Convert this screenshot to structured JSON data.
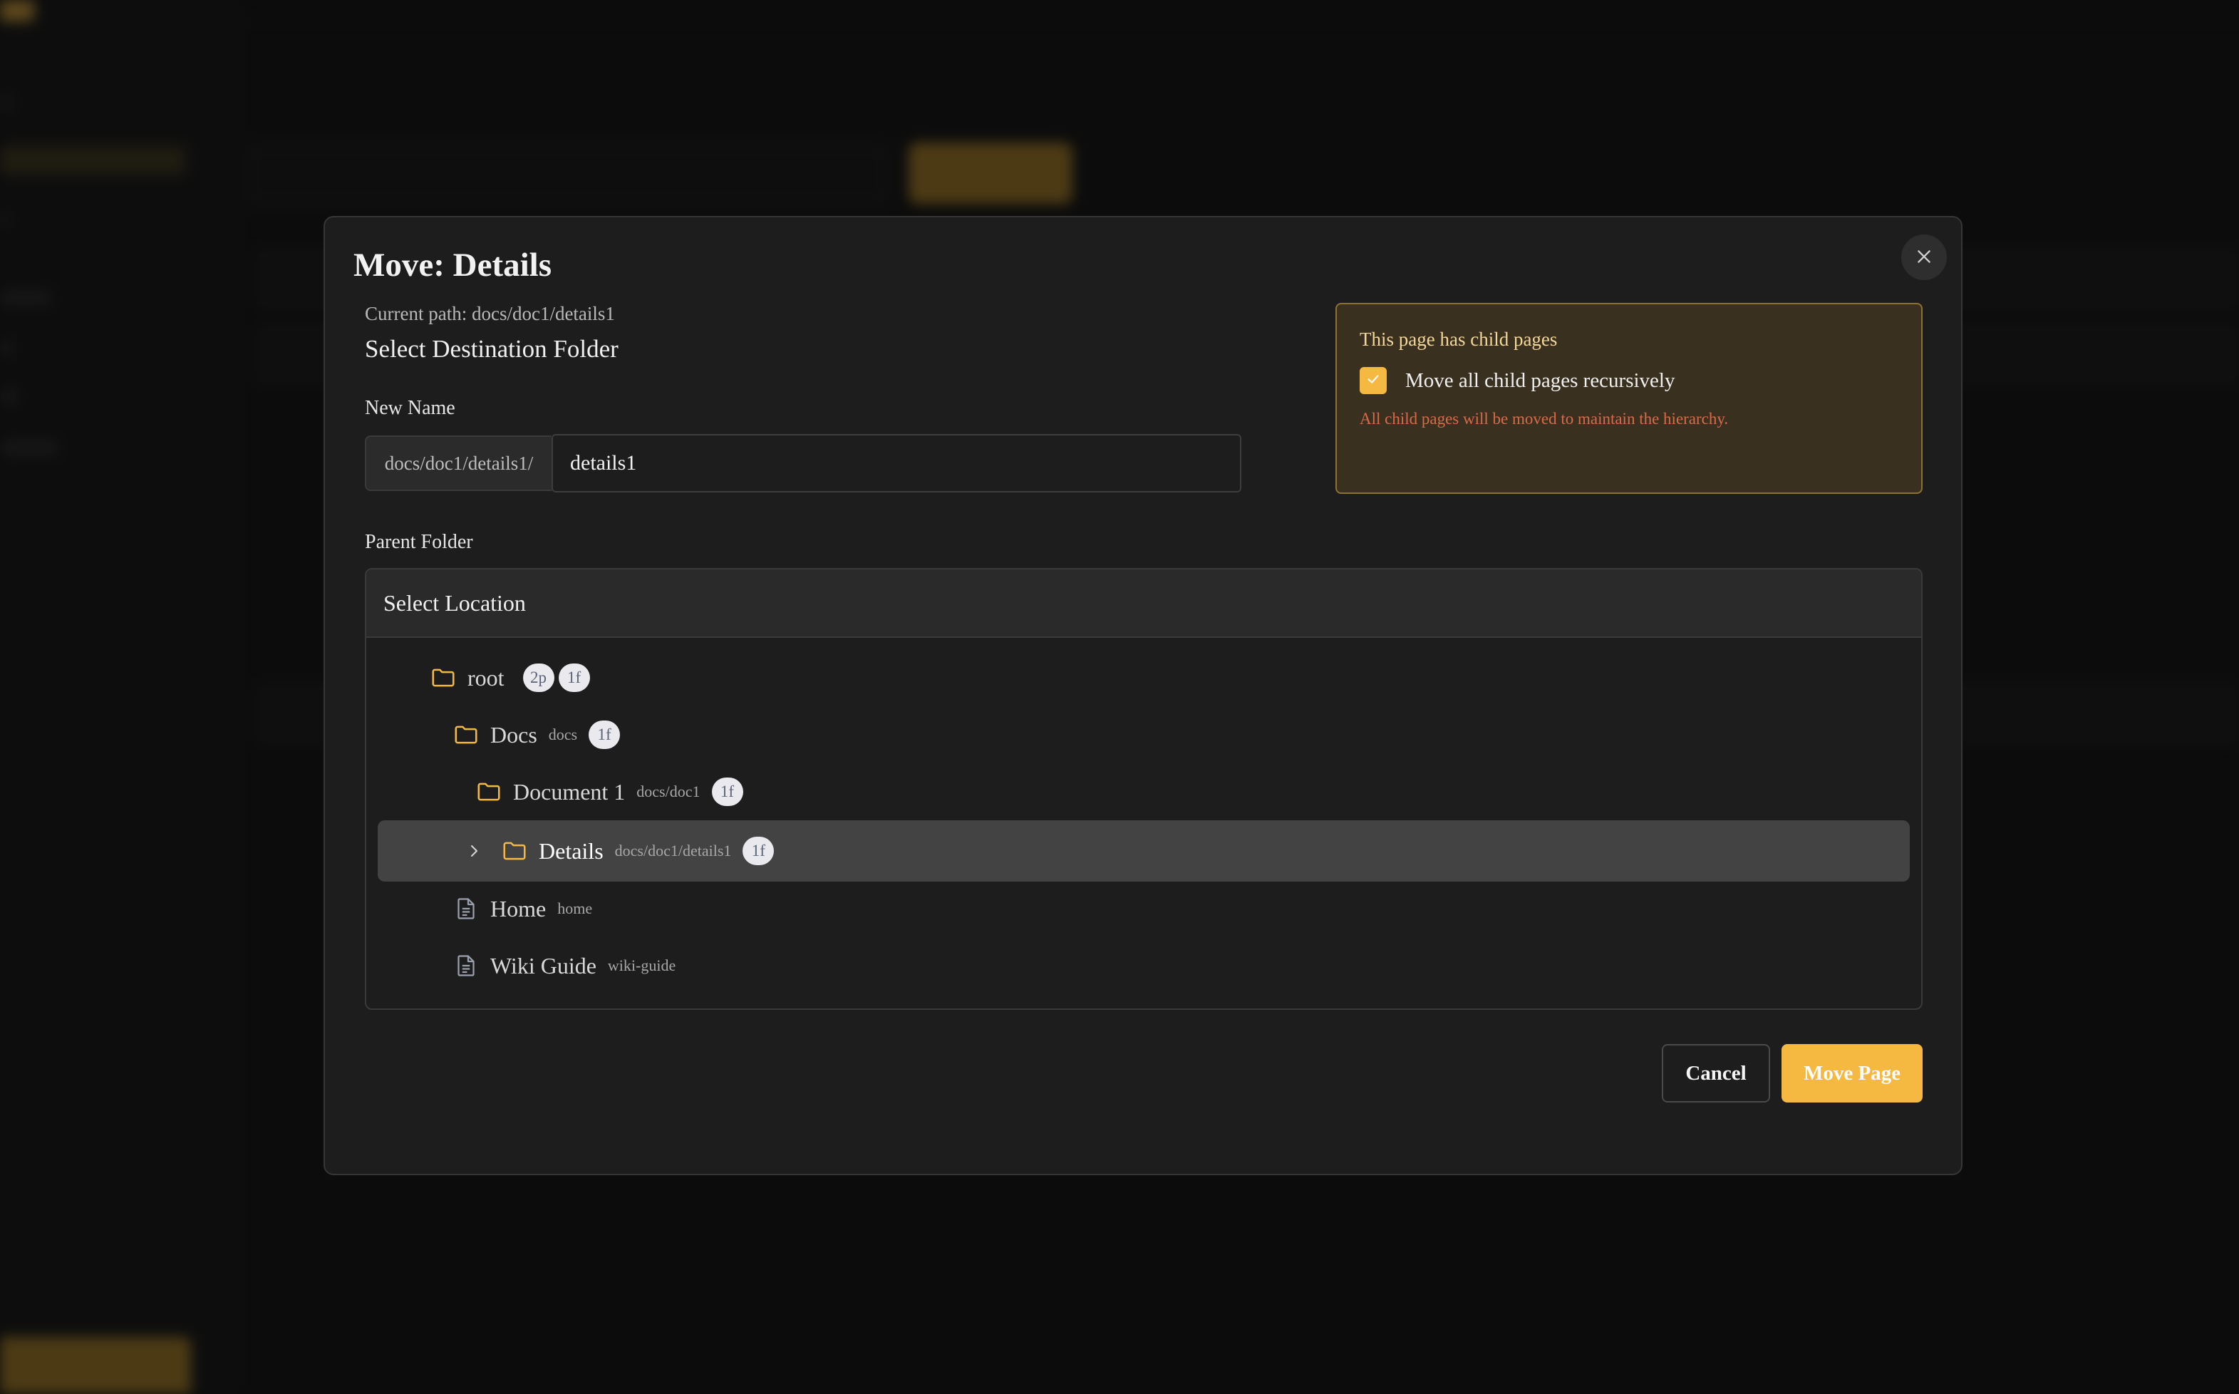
{
  "modal": {
    "title": "Move: Details",
    "current_path": "Current path: docs/doc1/details1",
    "section_title": "Select Destination Folder",
    "new_name_label": "New Name",
    "name_prefix": "docs/doc1/details1/",
    "name_value": "details1",
    "parent_folder_label": "Parent Folder",
    "location_header": "Select Location",
    "cancel_label": "Cancel",
    "move_label": "Move Page"
  },
  "warning": {
    "title": "This page has child pages",
    "checkbox_label": "Move all child pages recursively",
    "checked": true,
    "note": "All child pages will be moved to maintain the hierarchy."
  },
  "tree": [
    {
      "name": "root",
      "path": "",
      "badges": [
        "2p",
        "1f"
      ],
      "icon": "folder-icon"
    },
    {
      "name": "Docs",
      "path": "docs",
      "badges": [
        "1f"
      ],
      "icon": "folder-icon"
    },
    {
      "name": "Document 1",
      "path": "docs/doc1",
      "badges": [
        "1f"
      ],
      "icon": "folder-icon"
    },
    {
      "name": "Details",
      "path": "docs/doc1/details1",
      "badges": [
        "1f"
      ],
      "icon": "folder-icon",
      "selected": true
    },
    {
      "name": "Home",
      "path": "home",
      "badges": [],
      "icon": "file-text-icon"
    },
    {
      "name": "Wiki Guide",
      "path": "wiki-guide",
      "badges": [],
      "icon": "file-text-icon"
    }
  ],
  "colors": {
    "accent": "#f5b942",
    "modal_bg": "#1d1d1d",
    "selected_row": "#434343",
    "warning_bg": "#3a3020",
    "warning_text": "#d96a4a"
  },
  "icons": {
    "close": "close-icon",
    "checkbox": "check-icon",
    "expand": "chevron-right-icon"
  }
}
